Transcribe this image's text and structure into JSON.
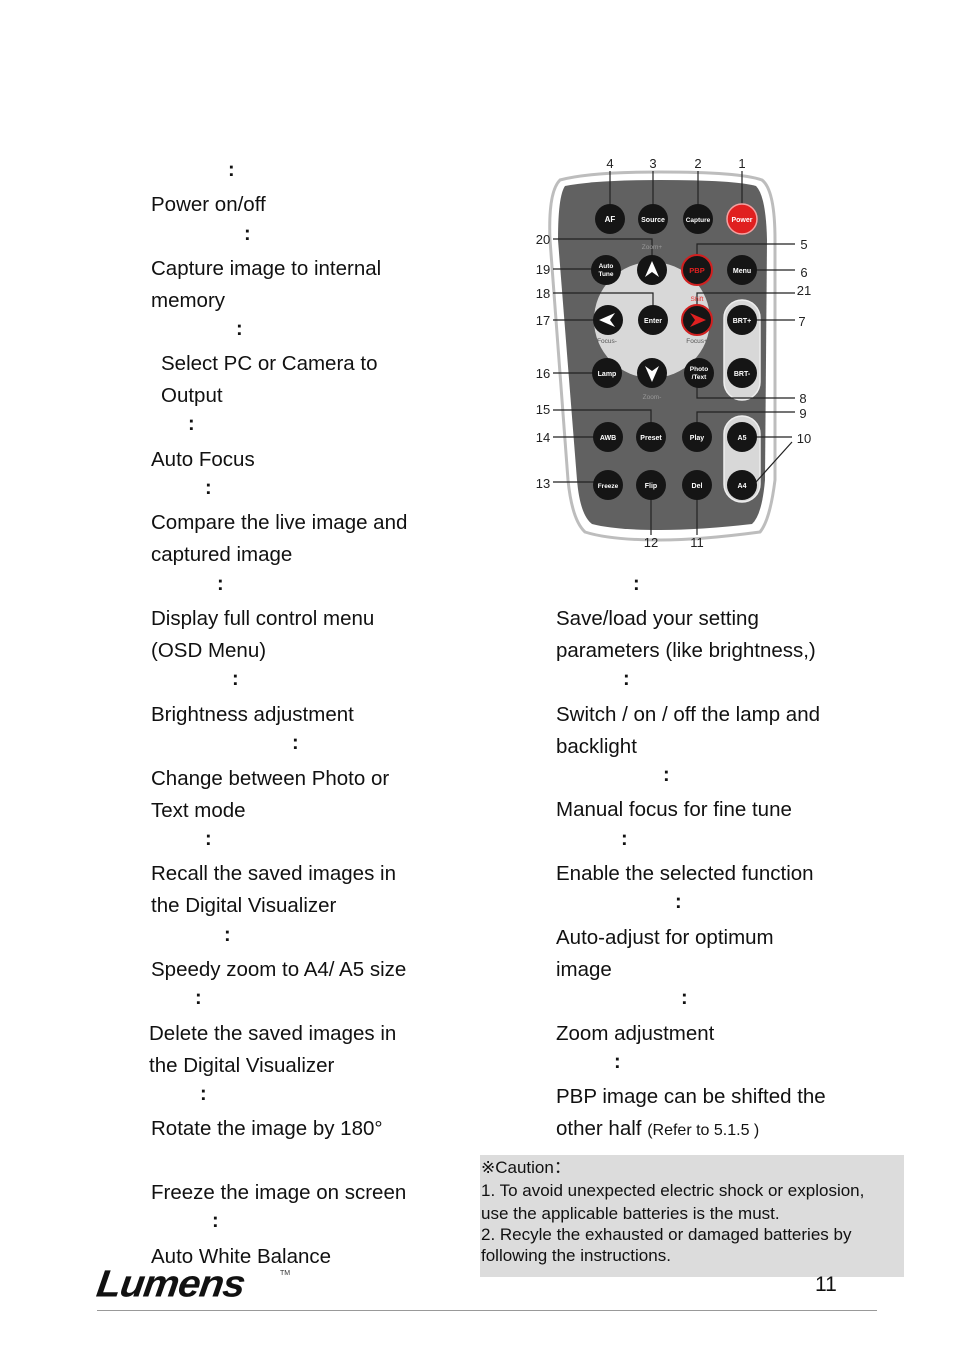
{
  "left_items": [
    {
      "colon": ":",
      "lines": [
        "Power on/off"
      ]
    },
    {
      "colon": ":",
      "lines": [
        "Capture image to internal",
        "memory"
      ]
    },
    {
      "colon": ":",
      "lines": [
        "Select PC or Camera to",
        "Output"
      ]
    },
    {
      "colon": ":",
      "lines": [
        "Auto Focus"
      ]
    },
    {
      "colon": ":",
      "lines": [
        "Compare the live image and",
        "captured image"
      ]
    },
    {
      "colon": ":",
      "lines": [
        "Display full control menu",
        "(OSD Menu)"
      ]
    },
    {
      "colon": ":",
      "lines": [
        "Brightness adjustment"
      ]
    },
    {
      "colon": ":",
      "lines": [
        "Change between Photo or",
        "Text mode"
      ]
    },
    {
      "colon": ":",
      "lines": [
        "Recall the saved images in",
        "the Digital Visualizer"
      ]
    },
    {
      "colon": ":",
      "lines": [
        "Speedy zoom to A4/ A5 size"
      ]
    },
    {
      "colon": ":",
      "lines": [
        "Delete the saved images in",
        "the Digital Visualizer"
      ]
    },
    {
      "colon": ":",
      "lines": [
        "Rotate the image by 180°"
      ]
    },
    {
      "colon": "",
      "lines": [
        "Freeze the image on screen"
      ]
    },
    {
      "colon": ":",
      "lines": [
        "Auto White Balance"
      ]
    }
  ],
  "right_items": [
    {
      "colon": ":",
      "lines": [
        "Save/load your setting",
        "parameters (like brightness,)"
      ]
    },
    {
      "colon": ":",
      "lines": [
        "Switch / on / off the lamp and",
        "backlight"
      ]
    },
    {
      "colon": ":",
      "lines": [
        "Manual focus for fine tune"
      ]
    },
    {
      "colon": ":",
      "lines": [
        "Enable the selected function"
      ]
    },
    {
      "colon": ":",
      "lines": [
        "Auto-adjust for optimum",
        "image"
      ]
    },
    {
      "colon": ":",
      "lines": [
        "Zoom adjustment"
      ]
    },
    {
      "colon": ":",
      "lines": [
        "PBP image can be shifted the",
        "other half"
      ],
      "note": "(Refer to 5.1.5 )"
    }
  ],
  "remote": {
    "buttons": {
      "af": "AF",
      "source": "Source",
      "capture": "Capture",
      "power": "Power",
      "auto_tune_1": "Auto",
      "auto_tune_2": "Tune",
      "pbp": "PBP",
      "menu": "Menu",
      "enter": "Enter",
      "brt_plus": "BRT+",
      "brt_minus": "BRT-",
      "lamp": "Lamp",
      "photo_1": "Photo",
      "photo_2": "/Text",
      "awb": "AWB",
      "preset": "Preset",
      "play": "Play",
      "a5": "A5",
      "a4": "A4",
      "freeze": "Freeze",
      "flip": "Flip",
      "del": "Del"
    },
    "labels": {
      "zoom_plus": "Zoom+",
      "zoom_minus": "Zoom-",
      "focus_minus": "Focus-",
      "focus_plus": "Focus+",
      "shift": "Shift"
    },
    "callouts": {
      "n1": "1",
      "n2": "2",
      "n3": "3",
      "n4": "4",
      "n5": "5",
      "n6": "6",
      "n7": "7",
      "n8": "8",
      "n9": "9",
      "n10": "10",
      "n11": "11",
      "n12": "12",
      "n13": "13",
      "n14": "14",
      "n15": "15",
      "n16": "16",
      "n17": "17",
      "n18": "18",
      "n19": "19",
      "n20": "20",
      "n21": "21"
    },
    "colors": {
      "body": "#616161",
      "button": "#151515",
      "power": "#e02020",
      "pad": "#d8d8d8"
    }
  },
  "caution": {
    "title": "※Caution：",
    "lines": [
      "1. To avoid unexpected electric shock or explosion,",
      "use the applicable batteries is the must.",
      "2. Recyle the exhausted or damaged batteries by",
      "following the instructions."
    ]
  },
  "footer": {
    "logo": "Lumens",
    "trademark": "TM",
    "page_number": "11"
  }
}
